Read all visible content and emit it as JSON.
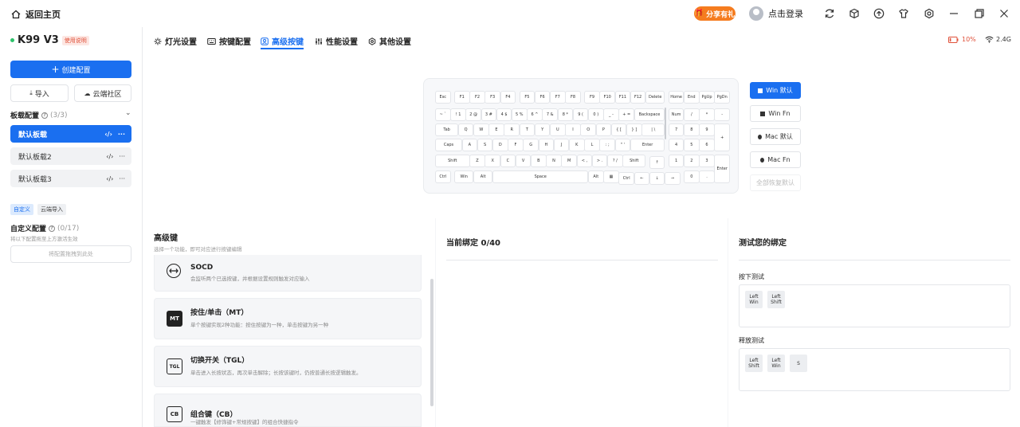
{
  "topbar": {
    "back_label": "返回主页",
    "share_label": "分享有礼",
    "login_label": "点击登录",
    "icons": [
      "sync-icon",
      "cube-icon",
      "upload-icon",
      "shirt-icon",
      "gear-icon",
      "minimize-icon",
      "restore-icon",
      "close-icon"
    ]
  },
  "device": {
    "name": "K99 V3",
    "badge": "使用说明"
  },
  "sidebar": {
    "create_label": "创建配置",
    "import_label": "导入",
    "cloud_label": "云端社区",
    "profiles_title": "板载配置",
    "profiles_count": "(3/3)",
    "profiles": [
      {
        "label": "默认板载",
        "active": true
      },
      {
        "label": "默认板载2",
        "active": false
      },
      {
        "label": "默认板载3",
        "active": false
      }
    ],
    "tag_custom": "自定义",
    "tag_cloud_import": "云端导入",
    "custom_title": "自定义配置",
    "custom_count": "(0/17)",
    "custom_hint": "将以下配置拖至上方激活生效",
    "drop_hint": "将配置拖拽到此处"
  },
  "tabs": [
    {
      "label": "灯光设置",
      "icon": "sun-icon",
      "active": false
    },
    {
      "label": "按键配置",
      "icon": "keyboard-icon",
      "active": false
    },
    {
      "label": "高级按键",
      "icon": "user-key-icon",
      "active": true
    },
    {
      "label": "性能设置",
      "icon": "sliders-icon",
      "active": false
    },
    {
      "label": "其他设置",
      "icon": "settings-icon",
      "active": false
    }
  ],
  "status": {
    "battery": "10%",
    "wireless": "2.4G"
  },
  "os_buttons": {
    "win_default": "Win 默认",
    "win_fn": "Win Fn",
    "mac_default": "Mac 默认",
    "mac_fn": "Mac Fn",
    "restore_all": "全部恢复默认"
  },
  "keys": {
    "row1": [
      "Esc",
      "F1",
      "F2",
      "F3",
      "F4",
      "F5",
      "F6",
      "F7",
      "F8",
      "F9",
      "F10",
      "F11",
      "F12",
      "Delete",
      "Home",
      "End",
      "PgUp",
      "PgDn"
    ],
    "row2": [
      "~ `",
      "! 1",
      "2 @",
      "3 #",
      "4 $",
      "5 %",
      "6 ^",
      "7 &",
      "8 *",
      "9 (",
      "0 )",
      "_ -",
      "+ =",
      "Backspace",
      "Num",
      "/",
      "*",
      "-"
    ],
    "row3": [
      "Tab",
      "Q",
      "W",
      "E",
      "R",
      "T",
      "Y",
      "U",
      "I",
      "O",
      "P",
      "{ [",
      "} ]",
      "| \\",
      "7",
      "8",
      "9"
    ],
    "row4": [
      "Caps",
      "A",
      "S",
      "D",
      "F",
      "G",
      "H",
      "J",
      "K",
      "L",
      ": ;",
      "\" '",
      "Enter",
      "4",
      "5",
      "6"
    ],
    "row5": [
      "Shift",
      "Z",
      "X",
      "C",
      "V",
      "B",
      "N",
      "M",
      "< ,",
      "> .",
      "? /",
      "Shift",
      "↑",
      "1",
      "2",
      "3"
    ],
    "row6": [
      "Ctrl",
      "Win",
      "Alt",
      "Space",
      "Alt",
      "Ctrl",
      "←",
      "↓",
      "→",
      "0",
      "."
    ],
    "numpad_plus": "+",
    "numpad_enter": "Enter"
  },
  "advanced": {
    "title": "高级键",
    "subtitle": "选择一个功能，即可对应进行按键编辑",
    "items": [
      {
        "icon_label": "",
        "title": "SOCD",
        "desc": "会监听两个已选按键，并根据设置规则触发对应输入"
      },
      {
        "icon_label": "MT",
        "title": "按住/单击（MT）",
        "desc": "单个按键实现2种功能：按住按键为一种，单击按键为另一种"
      },
      {
        "icon_label": "TGL",
        "title": "切换开关（TGL）",
        "desc": "单击进入长按状态，再次单击解除；长按该键时，仍按普通长按逻辑触发。"
      },
      {
        "icon_label": "CB",
        "title": "组合键（CB）",
        "desc": "一键触发【修饰键+常规按键】的组合快捷指令"
      }
    ]
  },
  "binding": {
    "title": "当前绑定 0/40"
  },
  "test": {
    "title": "测试您的绑定",
    "press_label": "按下测试",
    "press_keys": [
      "Left Win",
      "Left Shift"
    ],
    "release_label": "释放测试",
    "release_keys": [
      "Left Shift",
      "Left Win",
      "S"
    ]
  },
  "colors": {
    "accent": "#1a6ff0",
    "share": "#f57c1f",
    "battery": "#e0523b",
    "online": "#2ec36b"
  }
}
